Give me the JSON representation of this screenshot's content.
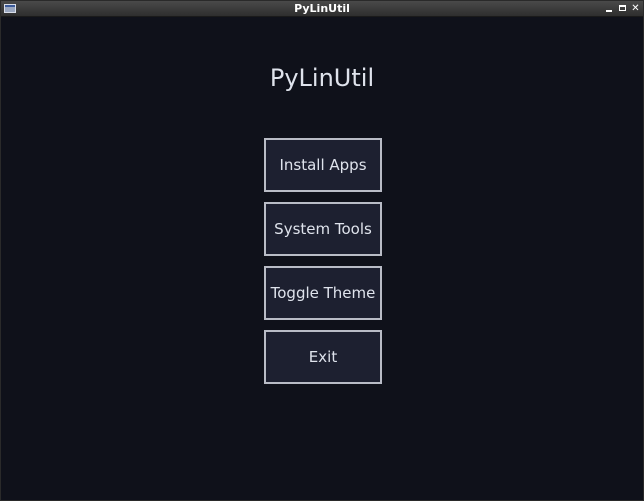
{
  "window": {
    "title": "PyLinUtil",
    "controls": {
      "minimize_icon": "minimize-icon",
      "maximize_icon": "maximize-icon",
      "close_glyph": "✕"
    }
  },
  "app": {
    "heading": "PyLinUtil"
  },
  "menu": {
    "buttons": [
      {
        "label": "Install Apps"
      },
      {
        "label": "System Tools"
      },
      {
        "label": "Toggle Theme"
      },
      {
        "label": "Exit"
      }
    ]
  },
  "colors": {
    "background": "#0f111a",
    "button_background": "#1d2030",
    "button_border": "#b9bcc6",
    "text": "#dfe3ec"
  }
}
